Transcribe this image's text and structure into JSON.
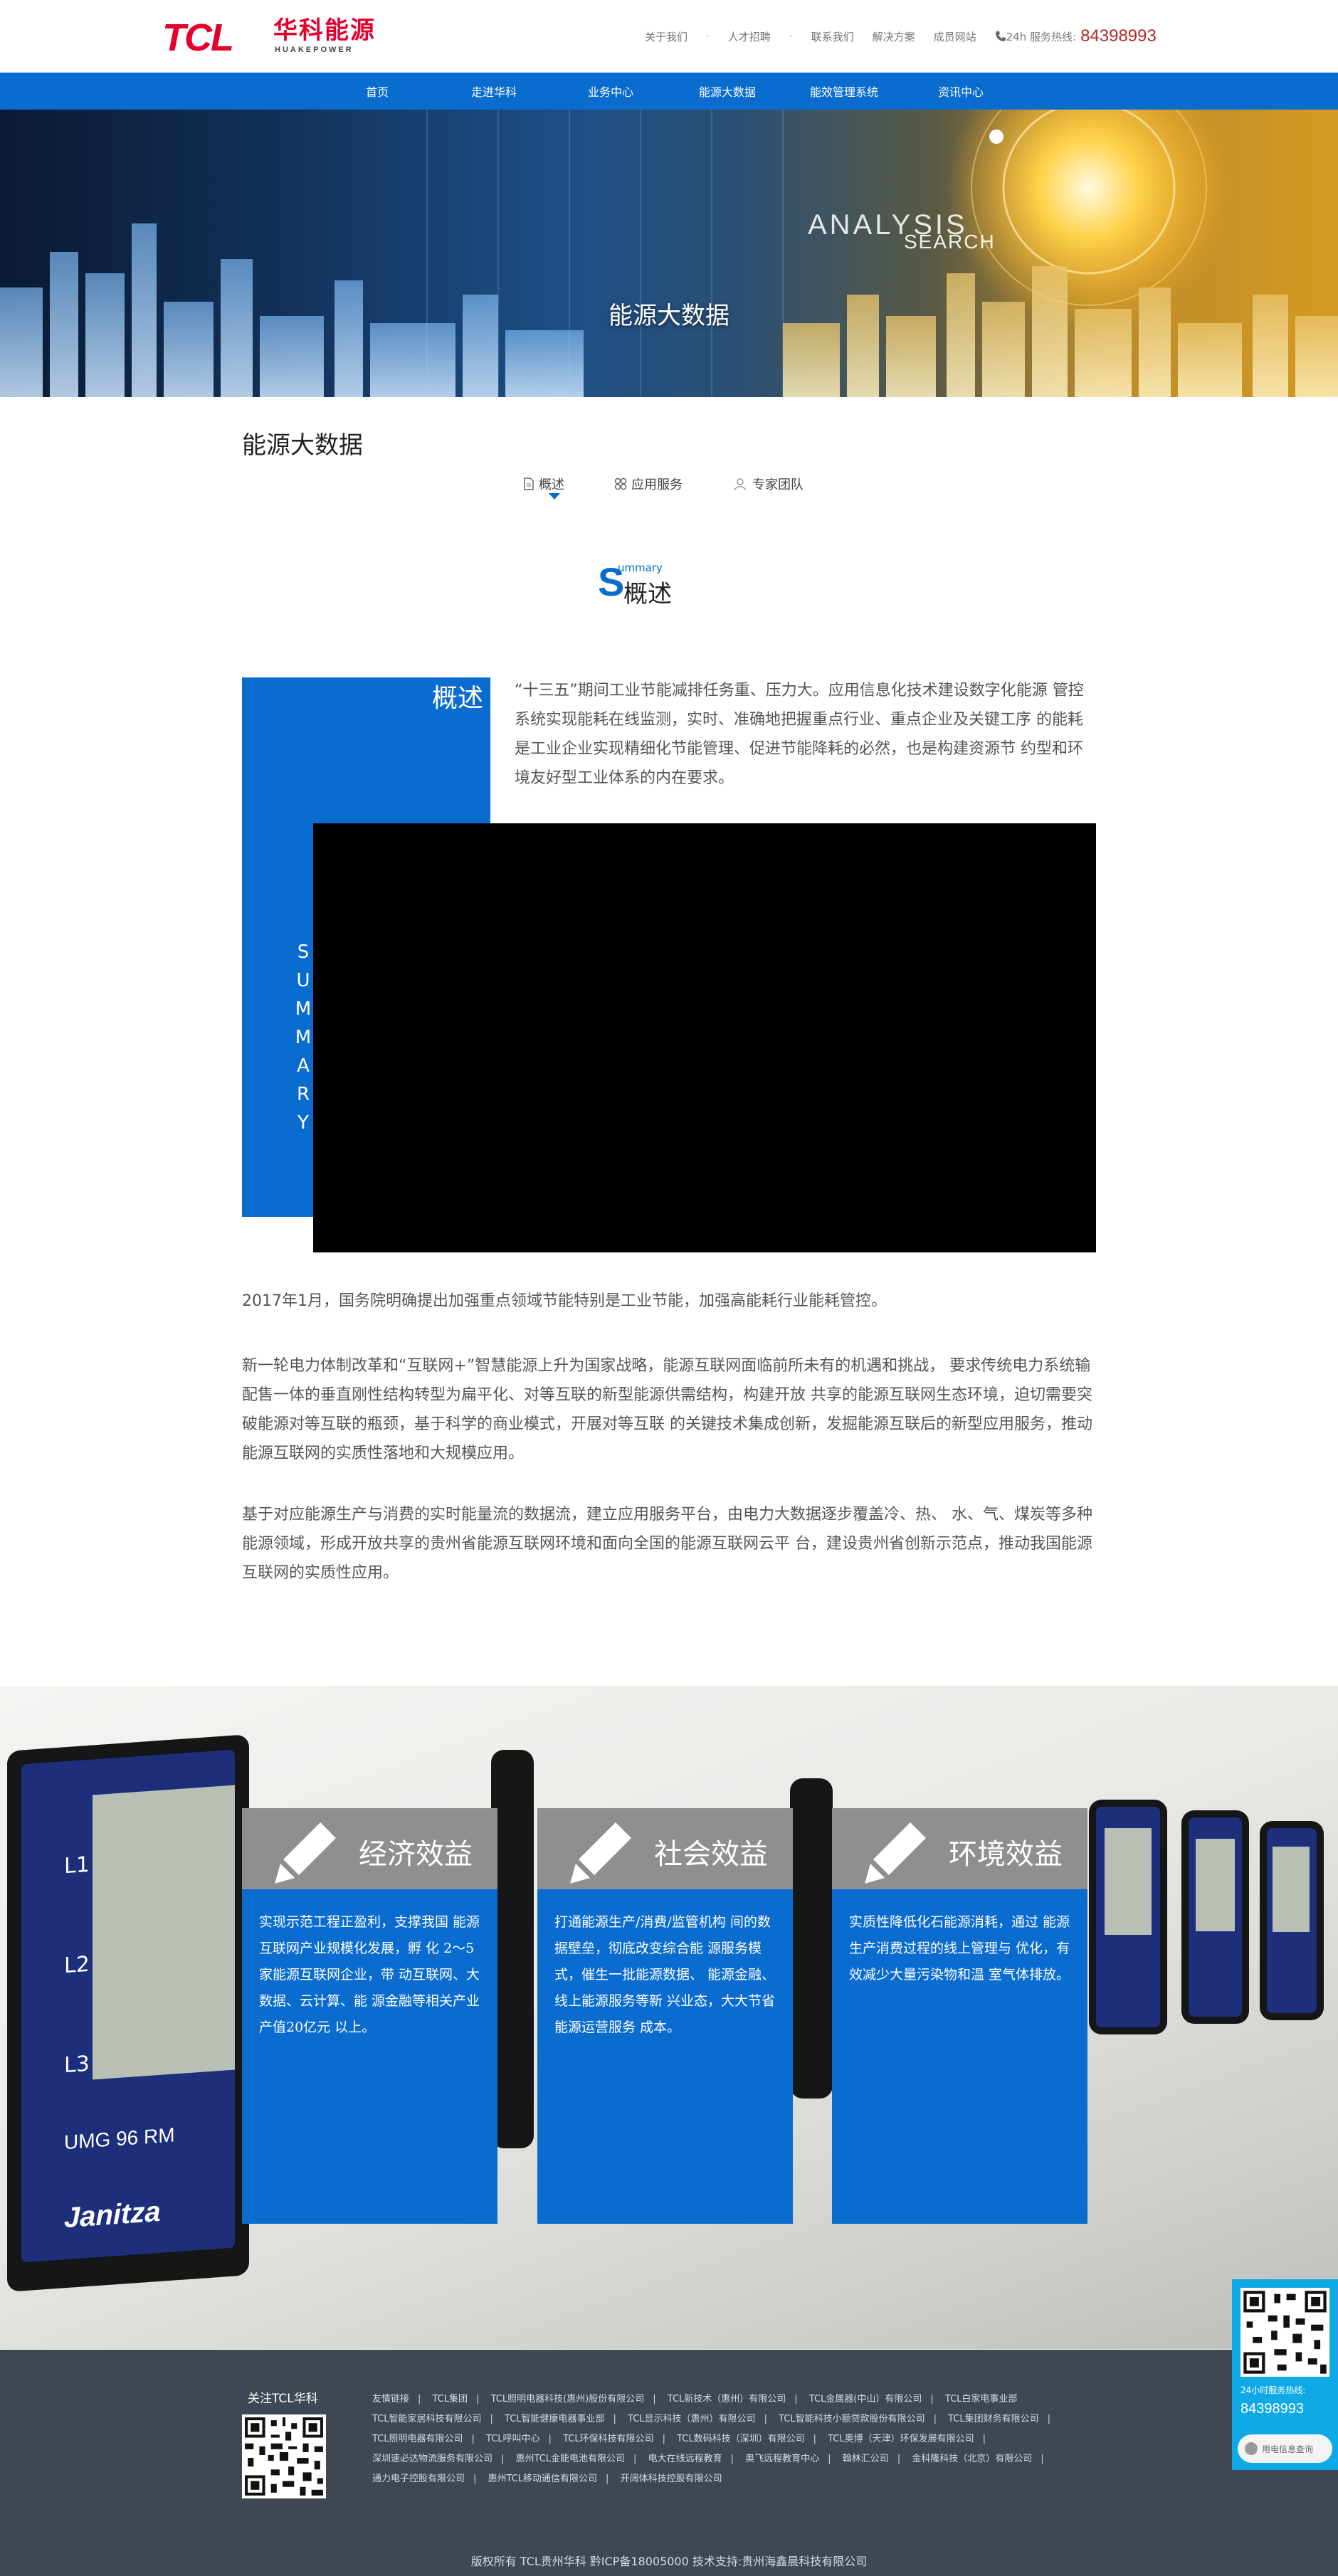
{
  "header": {
    "logo_tcl": "TCL",
    "logo_cn": "华科能源",
    "logo_en": "HUAKEPOWER",
    "links": [
      "关于我们",
      "人才招聘",
      "联系我们",
      "解决方案",
      "成员网站"
    ],
    "hotline_label": "24h 服务热线:",
    "hotline_number": "84398993"
  },
  "nav": {
    "items": [
      "首页",
      "走进华科",
      "业务中心",
      "能源大数据",
      "能效管理系统",
      "资讯中心"
    ]
  },
  "banner": {
    "title": "能源大数据",
    "word_search": "SEARCH",
    "word_analysis": "ANALYSIS"
  },
  "page": {
    "title": "能源大数据",
    "tabs": [
      {
        "label": "概述",
        "icon": "document-icon",
        "active": true
      },
      {
        "label": "应用服务",
        "icon": "grid-icon",
        "active": false
      },
      {
        "label": "专家团队",
        "icon": "team-icon",
        "active": false
      }
    ]
  },
  "section": {
    "letter": "S",
    "en": "ummary",
    "cn": "概述"
  },
  "summary": {
    "label": "概述",
    "vertical_letters": [
      "S",
      "U",
      "M",
      "M",
      "A",
      "R",
      "Y"
    ],
    "intro": "“十三五”期间工业节能减排任务重、压力大。应用信息化技术建设数字化能源 管控系统实现能耗在线监测，实时、准确地把握重点行业、重点企业及关键工序 的能耗是工业企业实现精细化节能管理、促进节能降耗的必然，也是构建资源节 约型和环境友好型工业体系的内在要求。",
    "p1": "2017年1月，国务院明确提出加强重点领域节能特别是工业节能，加强高能耗行业能耗管控。",
    "p2": "新一轮电力体制改革和“互联网+”智慧能源上升为国家战略，能源互联网面临前所未有的机遇和挑战， 要求传统电力系统输配售一体的垂直刚性结构转型为扁平化、对等互联的新型能源供需结构，构建开放 共享的能源互联网生态环境，迫切需要突破能源对等互联的瓶颈，基于科学的商业模式，开展对等互联 的关键技术集成创新，发掘能源互联后的新型应用服务，推动能源互联网的实质性落地和大规模应用。",
    "p3": "基于对应能源生产与消费的实时能量流的数据流，建立应用服务平台，由电力大数据逐步覆盖冷、热、 水、气、煤炭等多种能源领域，形成开放共享的贵州省能源互联网环境和面向全国的能源互联网云平 台，建设贵州省创新示范点，推动我国能源互联网的实质性应用。"
  },
  "benefits": [
    {
      "title": "经济效益",
      "text": "实现示范工程正盈利，支撑我国 能源互联网产业规模化发展，孵 化 2～5 家能源互联网企业，带 动互联网、大数据、云计算、能 源金融等相关产业产值20亿元 以上。"
    },
    {
      "title": "社会效益",
      "text": "打通能源生产/消费/监管机构 间的数据壁垒，彻底改变综合能 源服务模式，催生一批能源数据、 能源金融、线上能源服务等新 兴业态，大大节省能源运营服务 成本。"
    },
    {
      "title": "环境效益",
      "text": "实质性降低化石能源消耗，通过 能源生产消费过程的线上管理与 优化，有效减少大量污染物和温 室气体排放。"
    }
  ],
  "meter": {
    "labels": [
      "L1",
      "L2",
      "L3"
    ],
    "model": "UMG 96 RM",
    "brand": "Janitza"
  },
  "side_widget": {
    "hotline_label": "24小时服务热线:",
    "hotline_number": "84398993",
    "query_button": "用电信息查询"
  },
  "footer": {
    "follow": "关注TCL华科",
    "links": [
      "友情链接",
      "TCL集团",
      "TCL照明电器科技(惠州)股份有限公司",
      "TCL新技术（惠州）有限公司",
      "TCL金属器(中山）有限公司",
      "TCL白家电事业部",
      "TCL智能家居科技有限公司",
      "TCL智能健康电器事业部",
      "TCL显示科技（惠州）有限公司",
      "TCL智能科技小额贷款股份有限公司",
      "TCL集团财务有限公司",
      "TCL照明电器有限公司",
      "TCL呼叫中心",
      "TCL环保科技有限公司",
      "TCL数码科技（深圳）有限公司",
      "TCL奥博（天津）环保发展有限公司",
      "深圳速必达物流服务有限公司",
      "惠州TCL金能电池有限公司",
      "电大在线远程教育",
      "奥飞远程教育中心",
      "翰林汇公司",
      "金科隆科技（北京）有限公司",
      "通力电子控股有限公司",
      "惠州TCL移动通信有限公司",
      "开阔体科技控股有限公司"
    ],
    "copyright": "版权所有 TCL贵州华科 黔ICP备18005000 技术支持:贵州海鑫晨科技有限公司"
  }
}
